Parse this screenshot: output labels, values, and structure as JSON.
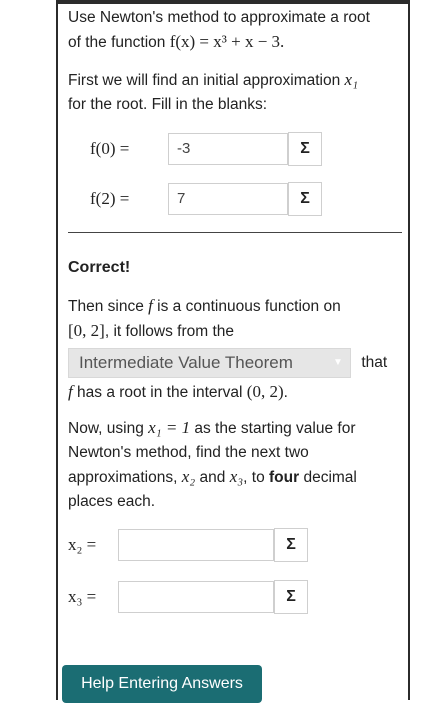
{
  "intro": {
    "line1": "Use Newton's method to approximate a root",
    "line2_prefix": "of the function ",
    "function_expr": "f(x) = x³ + x − 3."
  },
  "step1": {
    "text_a": "First we will find an initial approximation ",
    "x1": "x₁",
    "text_b": "for the root. Fill in the blanks:"
  },
  "inputs": [
    {
      "label": "f(0) =",
      "value": "-3"
    },
    {
      "label": "f(2) =",
      "value": "7"
    }
  ],
  "status": "Correct!",
  "step2": {
    "text_a": "Then since ",
    "f": "f",
    "text_b": " is a continuous function on",
    "interval": "[0, 2]",
    "text_c": ", it follows from the",
    "dropdown_value": "Intermediate Value Theorem",
    "text_d": "that",
    "text_e": " has a root in the interval ",
    "interval2": "(0, 2)",
    "text_f": "."
  },
  "step3": {
    "line1_a": "Now, using ",
    "x1_eq": "x₁ = 1",
    "line1_b": " as the starting value for",
    "line2": "Newton's method, find the next two",
    "line3_a": "approximations, ",
    "x2": "x₂",
    "line3_b": " and ",
    "x3": "x₃",
    "line3_c": ", to ",
    "bold": "four",
    "line3_d": " decimal",
    "line4": "places each."
  },
  "answers": [
    {
      "label": "x₂ =",
      "value": ""
    },
    {
      "label": "x₃ =",
      "value": ""
    }
  ],
  "sigma_label": "Σ",
  "help_button": "Help Entering Answers",
  "colors": {
    "accent": "#1b6d73",
    "dropdown_bg": "#e6e6e6"
  }
}
